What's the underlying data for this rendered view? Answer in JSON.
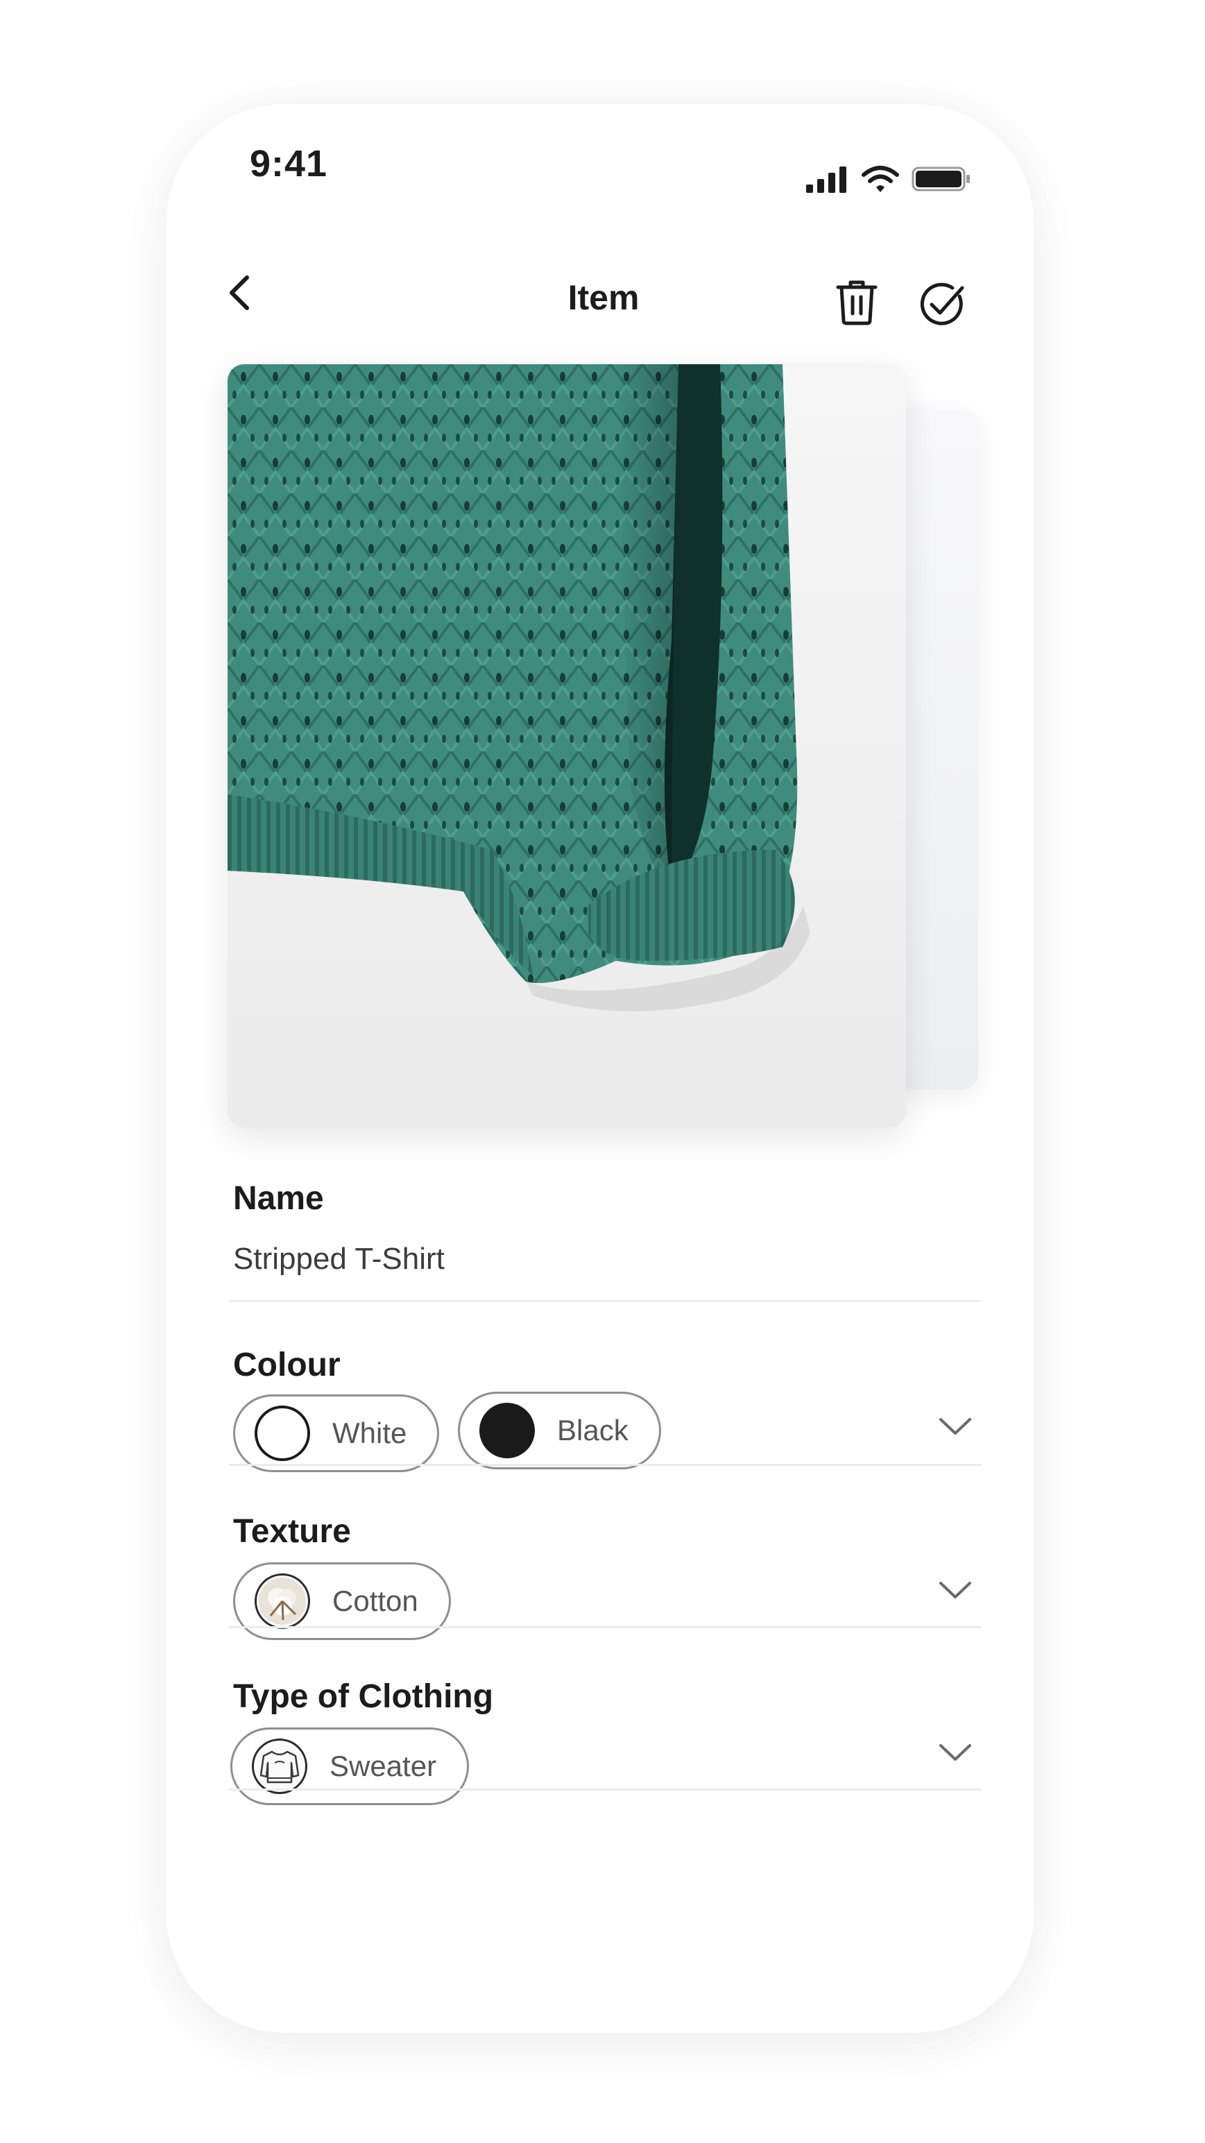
{
  "status_bar": {
    "time": "9:41"
  },
  "nav": {
    "title": "Item"
  },
  "form": {
    "name": {
      "label": "Name",
      "value": "Stripped T-Shirt"
    },
    "colour": {
      "label": "Colour",
      "chips": [
        {
          "label": "White",
          "swatch": "#ffffff"
        },
        {
          "label": "Black",
          "swatch": "#1a1a1a"
        }
      ]
    },
    "texture": {
      "label": "Texture",
      "chips": [
        {
          "label": "Cotton"
        }
      ]
    },
    "clothing_type": {
      "label": "Type of Clothing",
      "chips": [
        {
          "label": "Sweater"
        }
      ]
    }
  },
  "colors": {
    "knit_teal": "#3c8a7c",
    "text": "#1c1c1c",
    "chip_border": "#8e8e8e"
  },
  "icons": [
    "cellular-signal-icon",
    "wifi-icon",
    "battery-icon",
    "back-chevron-icon",
    "trash-icon",
    "check-circle-icon",
    "chevron-down-icon",
    "cotton-icon",
    "sweater-icon"
  ]
}
